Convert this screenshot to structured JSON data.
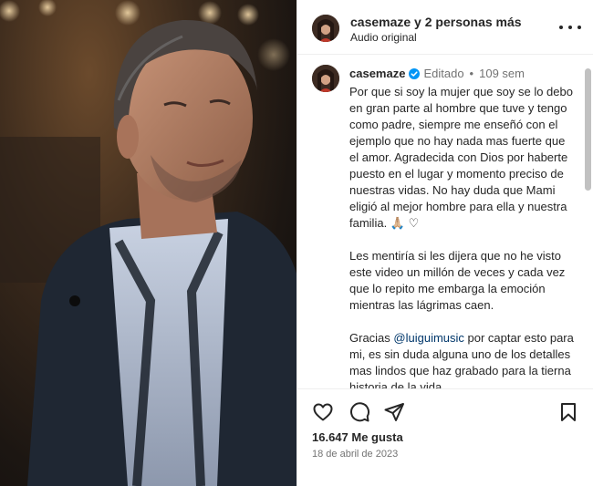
{
  "header": {
    "title": "casemaze y 2 personas más",
    "audio": "Audio original"
  },
  "caption": {
    "username": "casemaze",
    "edited": "Editado",
    "separator": "•",
    "time_ago": "109 sem",
    "paragraph1": "Por que si soy la mujer que soy se lo debo en gran parte al hombre que tuve y tengo como padre, siempre me enseñó con el ejemplo que no hay nada mas fuerte que el amor. Agradecida con Dios por haberte puesto en el lugar y momento preciso de nuestras vidas. No hay duda que Mami eligió al mejor hombre para ella y nuestra familia. 🙏🏼 ♡",
    "paragraph2": "Les mentiría si les dijera que no he visto este video un millón de veces y cada vez que lo repito me embarga la emoción mientras las lágrimas caen.",
    "paragraph3_prefix": "Gracias ",
    "paragraph3_mention": "@luiguimusic",
    "paragraph3_suffix": " por captar esto para mi, es sin duda alguna uno de los detalles mas lindos que haz grabado para la tierna historia de la vida"
  },
  "footer": {
    "likes": "16.647 Me gusta",
    "date": "18 de abril de 2023"
  },
  "icons": {
    "like": "heart-icon",
    "comment": "comment-icon",
    "share": "share-icon",
    "save": "bookmark-icon",
    "more": "more-icon",
    "verified": "verified-badge-icon"
  },
  "colors": {
    "verified": "#0095f6",
    "link": "#00376b",
    "secondary_text": "#737373"
  }
}
